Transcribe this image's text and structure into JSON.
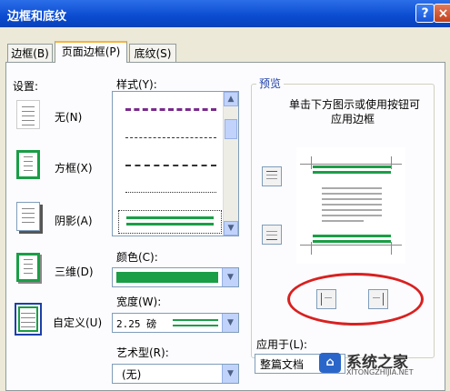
{
  "window": {
    "title": "边框和底纹",
    "help_label": "?",
    "close_label": "×"
  },
  "tabs": [
    {
      "label": "边框(B)",
      "active": false
    },
    {
      "label": "页面边框(P)",
      "active": true
    },
    {
      "label": "底纹(S)",
      "active": false
    }
  ],
  "settings": {
    "label": "设置:",
    "items": [
      {
        "label": "无(N)"
      },
      {
        "label": "方框(X)"
      },
      {
        "label": "阴影(A)"
      },
      {
        "label": "三维(D)"
      },
      {
        "label": "自定义(U)"
      }
    ]
  },
  "style": {
    "label": "样式(Y):"
  },
  "color": {
    "label": "颜色(C):",
    "value_color": "#1a9e46"
  },
  "width": {
    "label": "宽度(W):",
    "value": "2.25 磅"
  },
  "art": {
    "label": "艺术型(R):",
    "value": "(无)"
  },
  "preview": {
    "label": "预览",
    "instruction_line1": "单击下方图示或使用按钮可",
    "instruction_line2": "应用边框",
    "border_color": "#1a9e46"
  },
  "apply_to": {
    "label": "应用于(L):",
    "value": "整篇文档"
  },
  "watermark": {
    "text": "系统之家",
    "url": "XITONGZHIJIA.NET"
  },
  "annotation_color": "#d92020"
}
